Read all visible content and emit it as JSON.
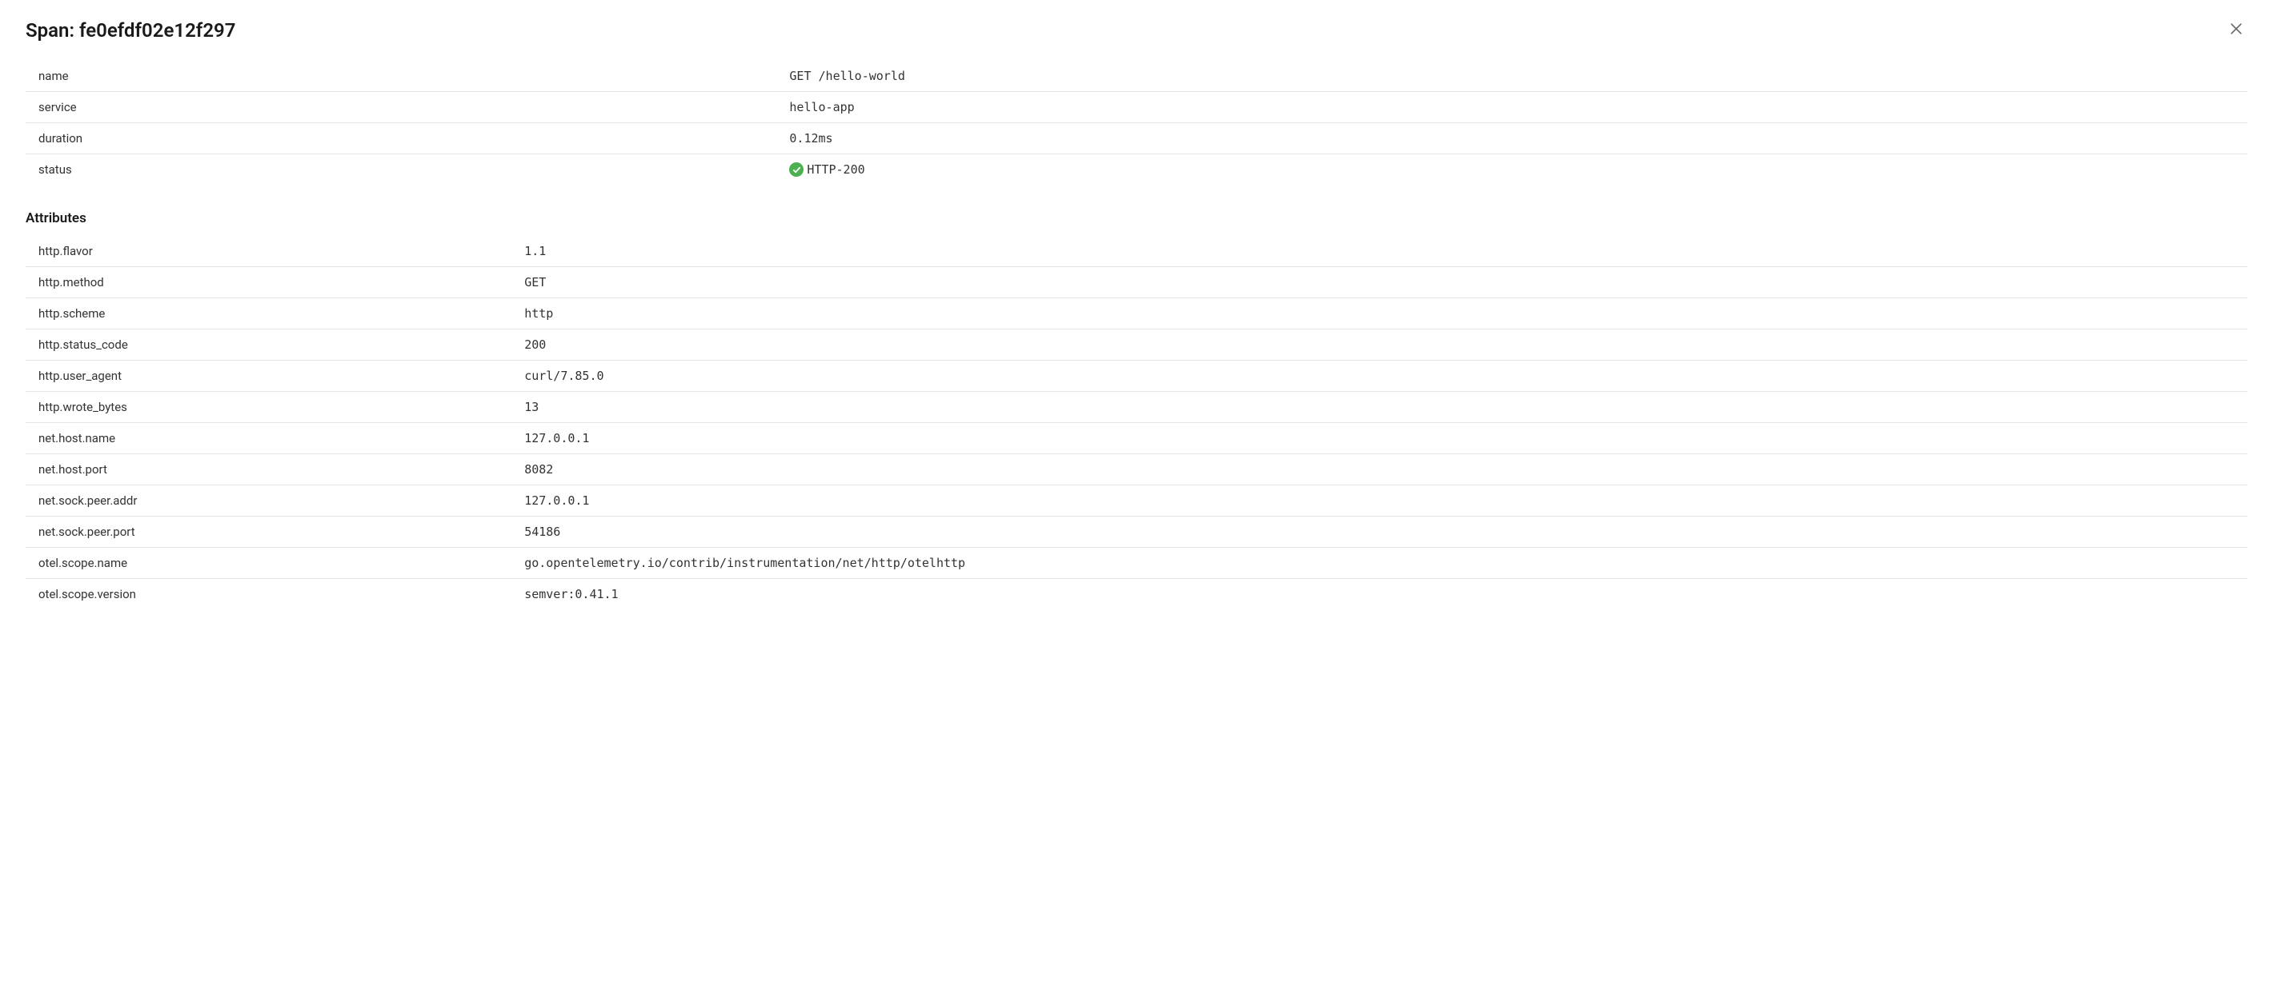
{
  "header": {
    "title_prefix": "Span: ",
    "span_id": "fe0efdf02e12f297"
  },
  "summary": {
    "rows": [
      {
        "label": "name",
        "value": "GET /hello-world"
      },
      {
        "label": "service",
        "value": "hello-app"
      },
      {
        "label": "duration",
        "value": "0.12ms"
      },
      {
        "label": "status",
        "value": "HTTP-200",
        "status_ok": true
      }
    ]
  },
  "attributes": {
    "title": "Attributes",
    "rows": [
      {
        "label": "http.flavor",
        "value": "1.1"
      },
      {
        "label": "http.method",
        "value": "GET"
      },
      {
        "label": "http.scheme",
        "value": "http"
      },
      {
        "label": "http.status_code",
        "value": "200"
      },
      {
        "label": "http.user_agent",
        "value": "curl/7.85.0"
      },
      {
        "label": "http.wrote_bytes",
        "value": "13"
      },
      {
        "label": "net.host.name",
        "value": "127.0.0.1"
      },
      {
        "label": "net.host.port",
        "value": "8082"
      },
      {
        "label": "net.sock.peer.addr",
        "value": "127.0.0.1"
      },
      {
        "label": "net.sock.peer.port",
        "value": "54186"
      },
      {
        "label": "otel.scope.name",
        "value": "go.opentelemetry.io/contrib/instrumentation/net/http/otelhttp"
      },
      {
        "label": "otel.scope.version",
        "value": "semver:0.41.1"
      }
    ]
  }
}
